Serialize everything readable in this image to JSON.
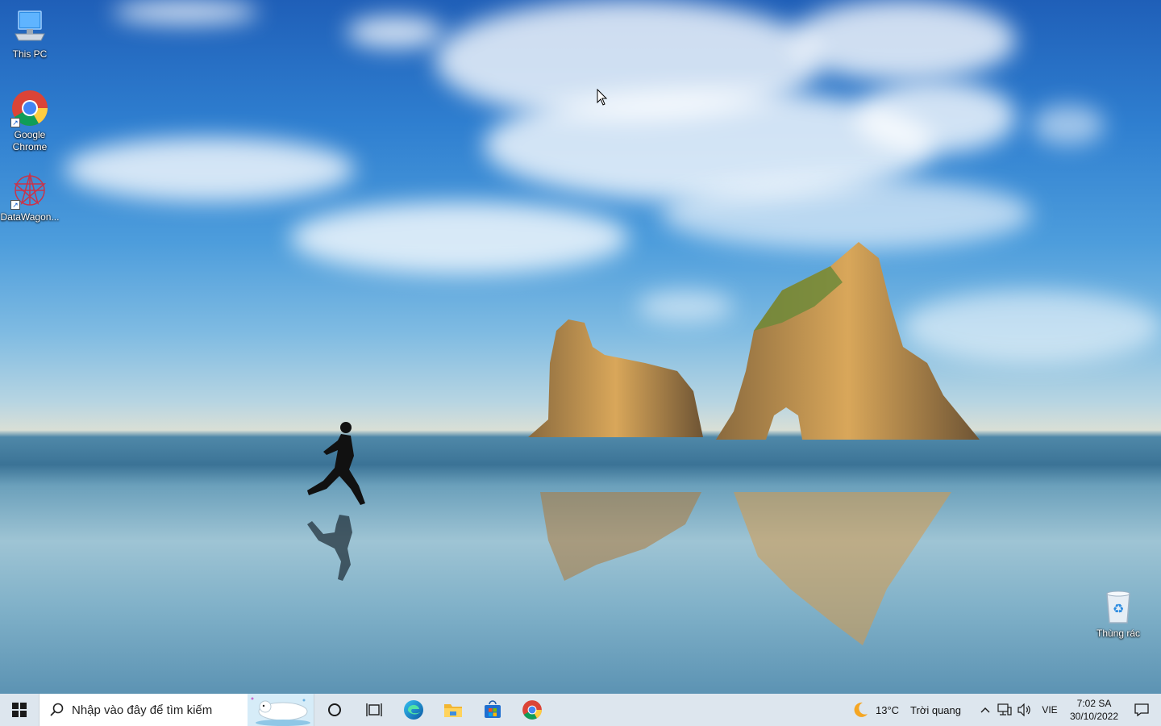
{
  "desktop": {
    "icons": [
      {
        "label": "This PC",
        "icon": "this-pc-icon"
      },
      {
        "label": "Google\nChrome",
        "icon": "chrome-icon"
      },
      {
        "label": "DataWagon...",
        "icon": "datawagon-icon"
      }
    ],
    "recycle_bin": {
      "label": "Thùng rác",
      "icon": "recycle-bin-icon"
    }
  },
  "taskbar": {
    "search": {
      "placeholder": "Nhập vào đây để tìm kiếm"
    },
    "apps": [
      "cortana-icon",
      "task-view-icon",
      "edge-icon",
      "file-explorer-icon",
      "store-icon",
      "chrome-icon"
    ],
    "weather": {
      "temp": "13°C",
      "condition": "Trời quang"
    },
    "language": "VIE",
    "time": "7:02 SA",
    "date": "30/10/2022"
  },
  "colors": {
    "taskbar_bg": "#dde6ee",
    "accent": "#0078d7"
  }
}
